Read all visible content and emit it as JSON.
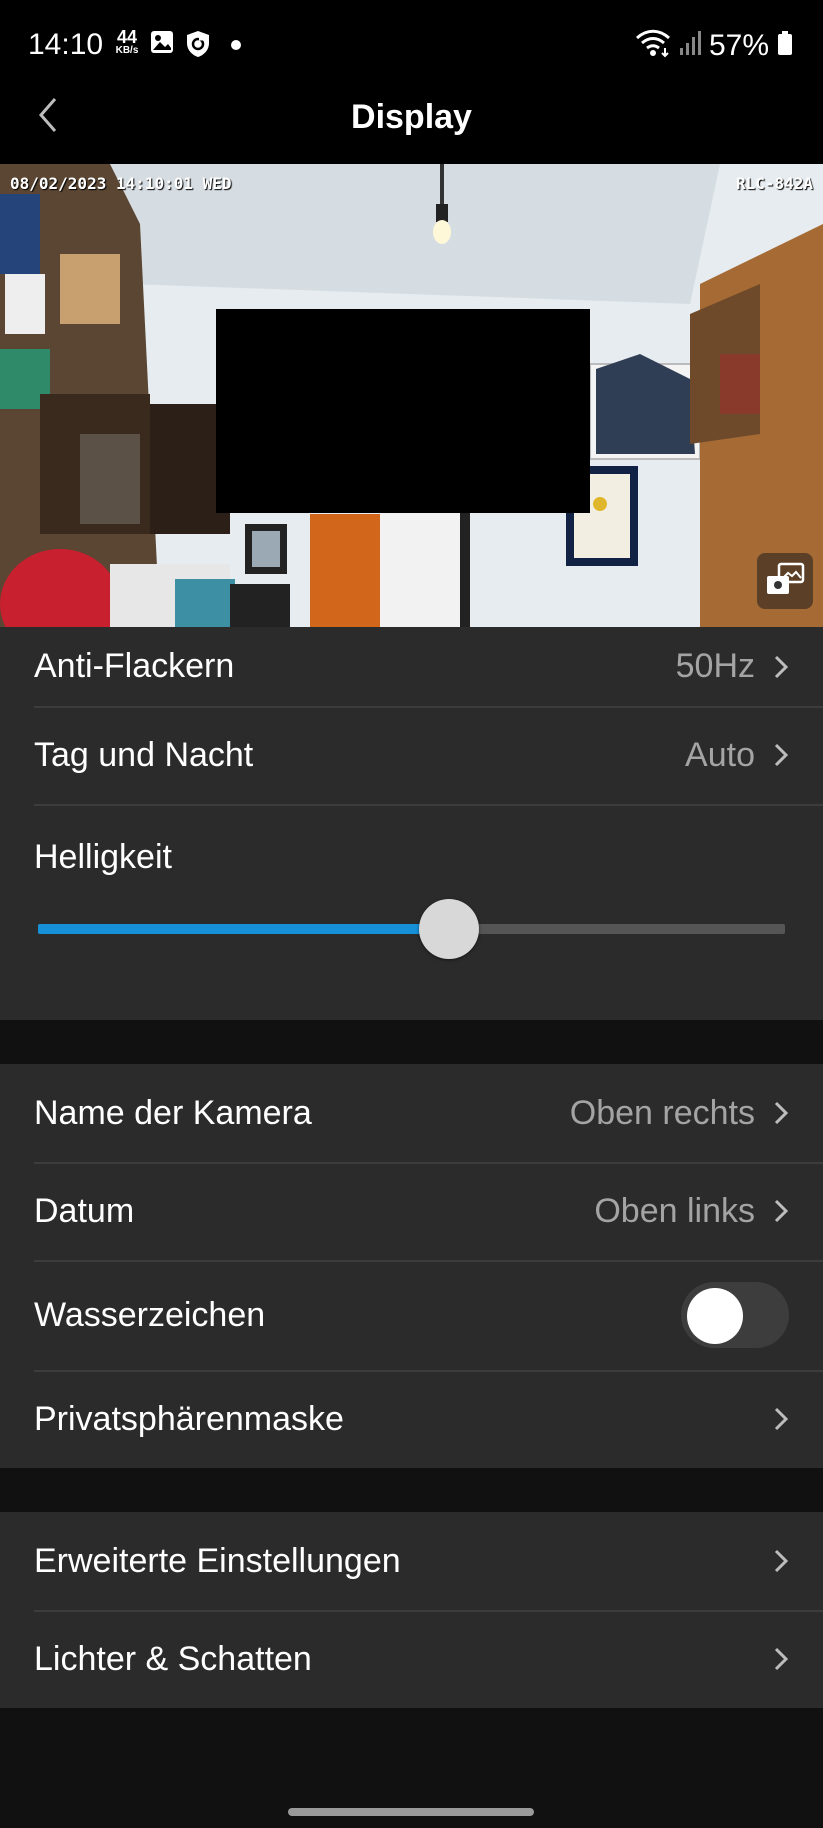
{
  "status_bar": {
    "time": "14:10",
    "speed_value": "44",
    "speed_unit": "KB/s",
    "battery_percent": "57%",
    "icons": [
      "image-icon",
      "shield-icon",
      "dot-icon",
      "wifi-icon",
      "signal-icon",
      "battery-icon"
    ]
  },
  "header": {
    "title": "Display"
  },
  "preview": {
    "timestamp": "08/02/2023 14:10:01 WED",
    "camera_name": "RLC-842A"
  },
  "settings": {
    "anti_flicker": {
      "label": "Anti-Flackern",
      "value": "50Hz"
    },
    "day_night": {
      "label": "Tag und Nacht",
      "value": "Auto"
    },
    "brightness": {
      "label": "Helligkeit",
      "level": 0.55
    },
    "camera_name": {
      "label": "Name der Kamera",
      "value": "Oben rechts"
    },
    "date": {
      "label": "Datum",
      "value": "Oben links"
    },
    "watermark": {
      "label": "Wasserzeichen",
      "enabled": false
    },
    "privacy_mask": {
      "label": "Privatsphärenmaske"
    },
    "advanced": {
      "label": "Erweiterte Einstellungen"
    },
    "lights_shadows": {
      "label": "Lichter & Schatten"
    }
  },
  "colors": {
    "accent": "#1691d8",
    "background": "#111111",
    "card": "#2b2b2b"
  }
}
